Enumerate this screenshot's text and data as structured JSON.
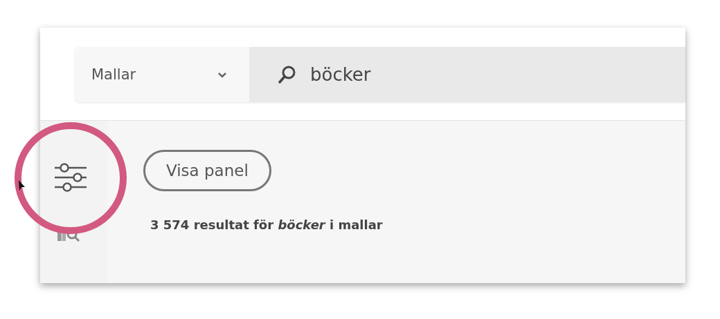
{
  "search": {
    "scope": "Mallar",
    "value": "böcker"
  },
  "panel_button": {
    "label": "Visa panel"
  },
  "results_summary": "3 574 resultat för *böcker* i mallar"
}
